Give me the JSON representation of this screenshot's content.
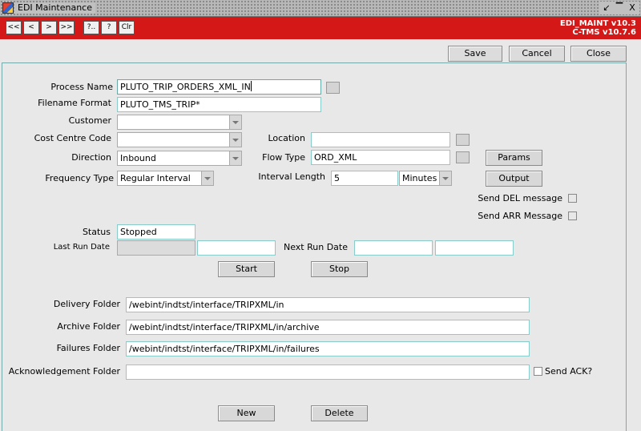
{
  "window": {
    "title": "EDI Maintenance",
    "controls": [
      "↙",
      "▔",
      "X"
    ]
  },
  "toolbar": {
    "nav_buttons": [
      "<<",
      "<",
      ">",
      ">>",
      "?..",
      "?",
      "Clr"
    ],
    "version_line1": "EDI_MAINT v10.3",
    "version_line2": "C-TMS v10.7.6",
    "accent": "#d41818"
  },
  "actions": {
    "save": "Save",
    "cancel": "Cancel",
    "close": "Close"
  },
  "form": {
    "process_name": {
      "label": "Process Name",
      "value": "PLUTO_TRIP_ORDERS_XML_IN"
    },
    "filename_format": {
      "label": "Filename Format",
      "value": "PLUTO_TMS_TRIP*"
    },
    "customer": {
      "label": "Customer",
      "value": ""
    },
    "cost_centre_code": {
      "label": "Cost Centre Code",
      "value": ""
    },
    "location": {
      "label": "Location",
      "value": ""
    },
    "direction": {
      "label": "Direction",
      "value": "Inbound"
    },
    "flow_type": {
      "label": "Flow Type",
      "value": "ORD_XML"
    },
    "frequency_type": {
      "label": "Frequency Type",
      "value": "Regular Interval"
    },
    "interval_length": {
      "label": "Interval Length",
      "value": "5",
      "unit": "Minutes"
    },
    "params_button": "Params",
    "output_button": "Output",
    "send_del": {
      "label": "Send DEL message",
      "checked": false
    },
    "send_arr": {
      "label": "Send ARR Message",
      "checked": false
    },
    "status": {
      "label": "Status",
      "value": "Stopped"
    },
    "last_run_date": {
      "label": "Last Run Date",
      "value1": "",
      "value2": ""
    },
    "next_run_date": {
      "label": "Next Run Date",
      "value1": "",
      "value2": ""
    },
    "start_button": "Start",
    "stop_button": "Stop",
    "delivery_folder": {
      "label": "Delivery Folder",
      "value": "/webint/indtst/interface/TRIPXML/in"
    },
    "archive_folder": {
      "label": "Archive Folder",
      "value": "/webint/indtst/interface/TRIPXML/in/archive"
    },
    "failures_folder": {
      "label": "Failures Folder",
      "value": "/webint/indtst/interface/TRIPXML/in/failures"
    },
    "acknowledgement_folder": {
      "label": "Acknowledgement Folder",
      "value": ""
    },
    "send_ack": {
      "label": "Send ACK?",
      "checked": false
    },
    "new_button": "New",
    "delete_button": "Delete"
  }
}
